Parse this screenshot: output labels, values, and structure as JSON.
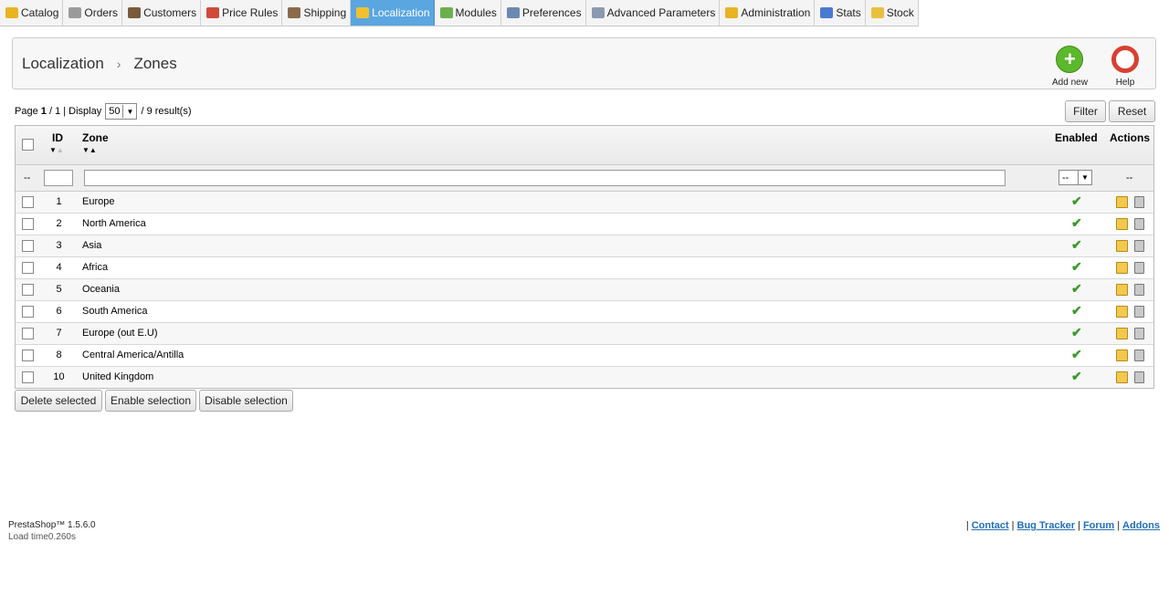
{
  "tabs": [
    {
      "label": "Catalog",
      "color": "#e8b323"
    },
    {
      "label": "Orders",
      "color": "#9a9a9a"
    },
    {
      "label": "Customers",
      "color": "#7a5a3a"
    },
    {
      "label": "Price Rules",
      "color": "#d04a3a"
    },
    {
      "label": "Shipping",
      "color": "#8a6a4a"
    },
    {
      "label": "Localization",
      "color": "#f0c030",
      "active": true
    },
    {
      "label": "Modules",
      "color": "#6ab04c"
    },
    {
      "label": "Preferences",
      "color": "#6a8ab0"
    },
    {
      "label": "Advanced Parameters",
      "color": "#8a9ab0"
    },
    {
      "label": "Administration",
      "color": "#e8b323"
    },
    {
      "label": "Stats",
      "color": "#4a7ad0"
    },
    {
      "label": "Stock",
      "color": "#e8c040"
    }
  ],
  "breadcrumb": {
    "parent": "Localization",
    "separator": "›",
    "current": "Zones"
  },
  "toolbar": {
    "add_new": "Add new",
    "help": "Help"
  },
  "pager": {
    "page_label": "Page",
    "page": "1",
    "of": "/ 1 | Display",
    "display": "50",
    "results": "/ 9 result(s)"
  },
  "filter_label": "Filter",
  "reset_label": "Reset",
  "columns": {
    "id": "ID",
    "zone": "Zone",
    "enabled": "Enabled",
    "actions": "Actions"
  },
  "filter_row": {
    "left_dash": "--",
    "enabled_select": "--",
    "actions_dash": "--"
  },
  "rows": [
    {
      "id": "1",
      "zone": "Europe"
    },
    {
      "id": "2",
      "zone": "North America"
    },
    {
      "id": "3",
      "zone": "Asia"
    },
    {
      "id": "4",
      "zone": "Africa"
    },
    {
      "id": "5",
      "zone": "Oceania"
    },
    {
      "id": "6",
      "zone": "South America"
    },
    {
      "id": "7",
      "zone": "Europe (out E.U)"
    },
    {
      "id": "8",
      "zone": "Central America/Antilla"
    },
    {
      "id": "10",
      "zone": "United Kingdom"
    }
  ],
  "bulk": {
    "delete": "Delete selected",
    "enable": "Enable selection",
    "disable": "Disable selection"
  },
  "footer": {
    "version": "PrestaShop™ 1.5.6.0",
    "load": "Load time0.260s",
    "sep": "|",
    "links": [
      "Contact",
      "Bug Tracker",
      "Forum",
      "Addons"
    ]
  }
}
